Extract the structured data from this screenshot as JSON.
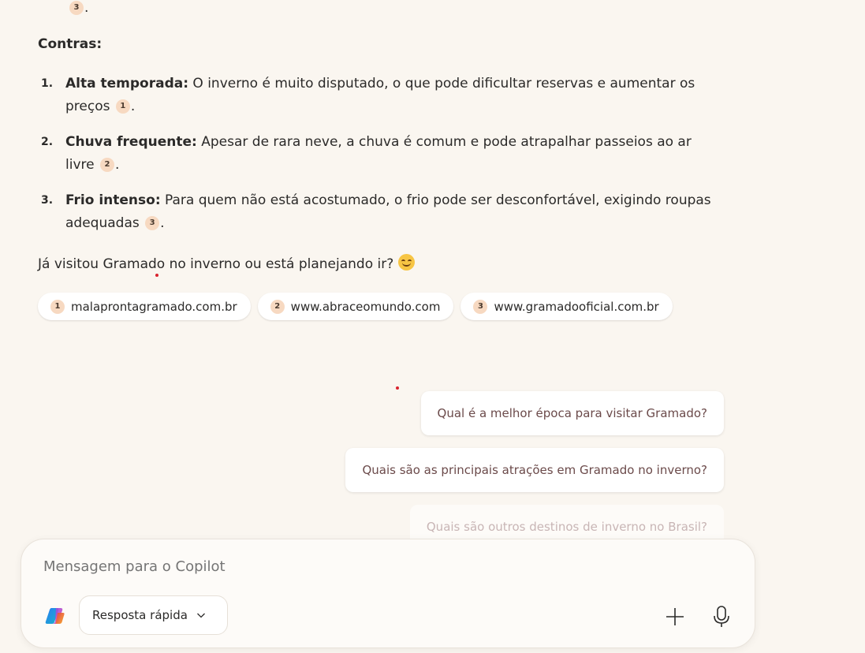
{
  "top_fragment": {
    "cite": "3",
    "tail": "."
  },
  "cons": {
    "title": "Contras:",
    "items": [
      {
        "num": "1.",
        "bold": "Alta temporada:",
        "text": " O inverno é muito disputado, o que pode dificultar reservas e aumentar os preços",
        "cite": "1",
        "end": "."
      },
      {
        "num": "2.",
        "bold": "Chuva frequente:",
        "text": " Apesar de rara neve, a chuva é comum e pode atrapalhar passeios ao ar livre",
        "cite": "2",
        "end": "."
      },
      {
        "num": "3.",
        "bold": "Frio intenso:",
        "text": " Para quem não está acostumado, o frio pode ser desconfortável, exigindo roupas adequadas",
        "cite": "3",
        "end": "."
      }
    ]
  },
  "closing": {
    "text": "Já visitou Gramado no inverno ou está planejando ir?",
    "emoji": "smiling-face-emoji"
  },
  "sources": [
    {
      "num": "1",
      "label": "malaprontagramado.com.br"
    },
    {
      "num": "2",
      "label": "www.abraceomundo.com"
    },
    {
      "num": "3",
      "label": "www.gramadooficial.com.br"
    }
  ],
  "suggestions": [
    "Qual é a melhor época para visitar Gramado?",
    "Quais são as principais atrações em Gramado no inverno?",
    "Quais são outros destinos de inverno no Brasil?"
  ],
  "composer": {
    "placeholder": "Mensagem para o Copilot",
    "mode_label": "Resposta rápida",
    "icons": {
      "logo": "copilot-logo-icon",
      "mode": "chevron-down-icon",
      "add": "plus-icon",
      "voice": "microphone-icon"
    }
  },
  "colors": {
    "background": "#faf6f0",
    "citation": "#f7d9c1",
    "suggestion_text": "#6b4a4a"
  }
}
